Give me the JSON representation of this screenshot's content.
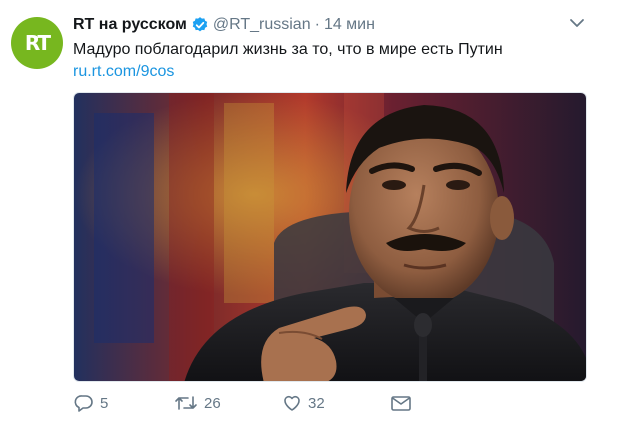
{
  "tweet": {
    "avatar_label": "RT",
    "author_name": "RT на русском",
    "handle": "@RT_russian",
    "separator": "·",
    "time": "14 мин",
    "text": "Мадуро поблагодарил жизнь за то, что в мире есть Путин",
    "link": "ru.rt.com/9cos"
  },
  "actions": {
    "reply_count": "5",
    "retweet_count": "26",
    "like_count": "32"
  },
  "colors": {
    "avatar_bg": "#77b71f",
    "link": "#1b95e0",
    "verified": "#1da1f2",
    "muted": "#657786"
  },
  "icons": {
    "verified": "verified-badge-icon",
    "menu": "chevron-down-icon",
    "reply": "reply-icon",
    "retweet": "retweet-icon",
    "like": "heart-icon",
    "dm": "envelope-icon"
  }
}
